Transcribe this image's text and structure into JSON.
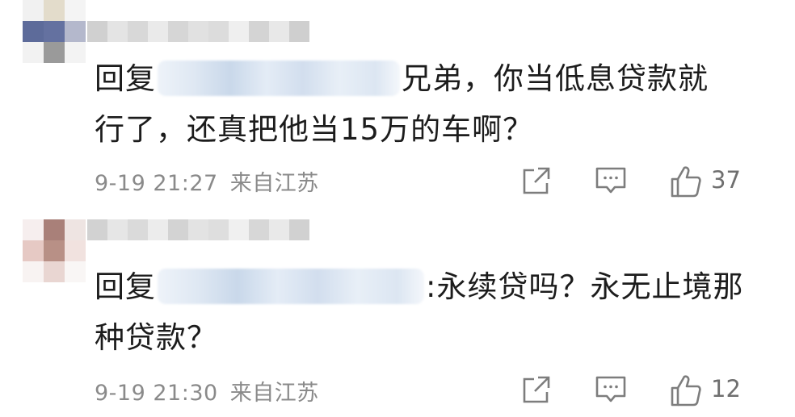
{
  "comments": [
    {
      "reply_prefix": "回复",
      "text_after_mention": "兄弟，你当低息贷款就",
      "text_line2": "行了，还真把他当15万的车啊？",
      "timestamp": "9-19 21:27",
      "location": "来自江苏",
      "like_count": "37"
    },
    {
      "reply_prefix": "回复",
      "text_after_mention": ":永续贷吗？永无止境那",
      "text_line2": "种贷款？",
      "timestamp": "9-19 21:30",
      "location": "来自江苏",
      "like_count": "12"
    }
  ],
  "icons": {
    "share": "share-icon",
    "comment": "comment-icon",
    "like": "thumbs-up-icon"
  }
}
